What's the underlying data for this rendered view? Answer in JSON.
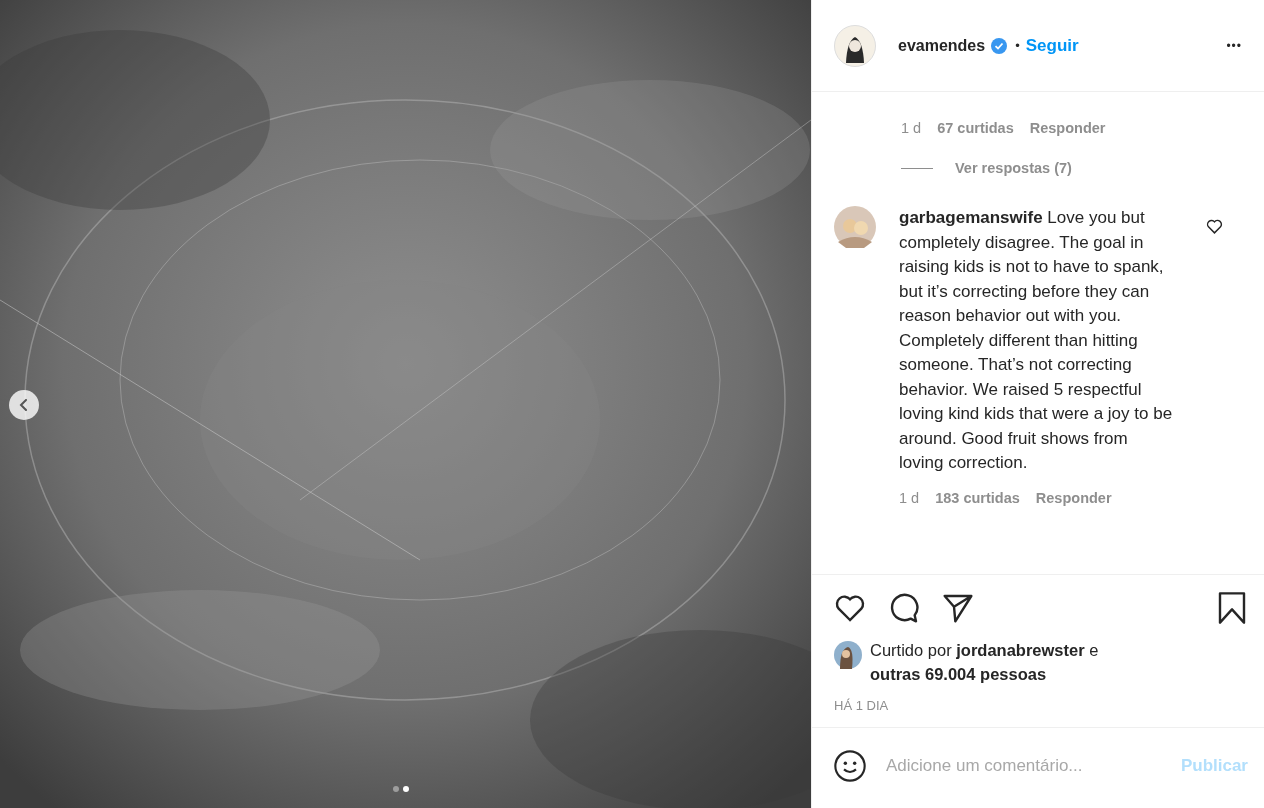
{
  "post": {
    "carousel": {
      "dots": [
        {
          "selected": false
        },
        {
          "selected": true
        }
      ]
    }
  },
  "header": {
    "username": "evamendes",
    "verified": true,
    "separator": "•",
    "follow": "Seguir",
    "more": "•••"
  },
  "previous_comment": {
    "time": "1 d",
    "likes": "67 curtidas",
    "reply": "Responder",
    "view_replies": "Ver respostas (7)"
  },
  "comments": [
    {
      "username": "garbagemanswife",
      "text": "Love you but completely disagree. The goal in raising kids is not to have to spank, but it’s correcting before they can reason behavior out with you. Completely different than hitting someone. That’s not correcting behavior. We raised 5 respectful loving kind kids that were a joy to be around. Good fruit shows from loving correction.",
      "time": "1 d",
      "likes": "183 curtidas",
      "reply": "Responder",
      "liked": false
    }
  ],
  "actions": {
    "liked": false,
    "saved": false
  },
  "likes": {
    "prefix": "Curtido por",
    "user": "jordanabrewster",
    "conj": "e",
    "others": "outras 69.004 pessoas"
  },
  "date": "HÁ 1 DIA",
  "comment_box": {
    "placeholder": "Adicione um comentário...",
    "submit": "Publicar"
  }
}
